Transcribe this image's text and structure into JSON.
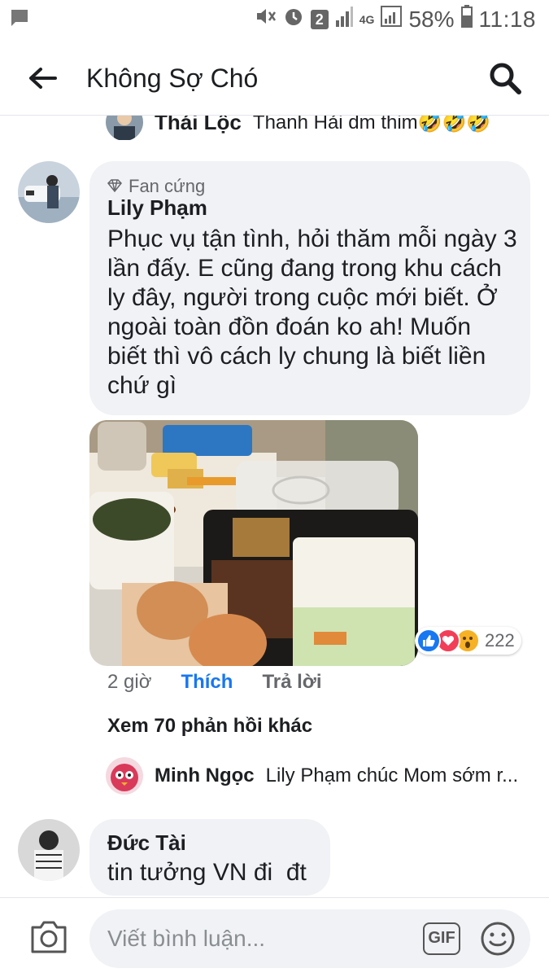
{
  "status_bar": {
    "sim_badge": "2",
    "network": "4G",
    "battery": "58%",
    "time": "11:18"
  },
  "header": {
    "title": "Không Sợ Chó"
  },
  "top_reply": {
    "name": "Thái Lộc",
    "text": "Thanh Hải dm thim🤣🤣🤣"
  },
  "comment": {
    "badge": "Fan cứng",
    "author": "Lily Phạm",
    "lines": [
      "Phục vụ tận tình, hỏi thăm mỗi ngày 3",
      "lần đấy. E cũng đang trong khu cách",
      "ly đây, người trong cuộc mới biết. Ở",
      "ngoài toàn đồn đoán ko ah! Muốn",
      "biết thì vô cách ly chung là biết liền",
      "chứ gì"
    ],
    "reaction_icons": [
      "like-icon",
      "love-icon",
      "wow-icon"
    ],
    "reaction_count": "222",
    "time": "2 giờ",
    "like_label": "Thích",
    "reply_label": "Trả lời",
    "more_replies": "Xem 70 phản hồi khác",
    "reply_preview": {
      "name": "Minh Ngọc",
      "text": "Lily Phạm chúc Mom sớm r..."
    }
  },
  "comment2": {
    "author": "Đức Tài",
    "text": "tin tưởng VN đi  đt"
  },
  "composer": {
    "placeholder": "Viết bình luận...",
    "gif_label": "GIF"
  },
  "colors": {
    "accent": "#1877f2",
    "bubble": "#f0f2f5",
    "muted": "#65676b"
  }
}
